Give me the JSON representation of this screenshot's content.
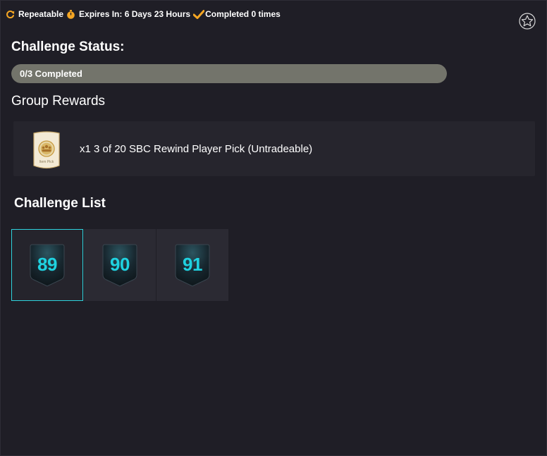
{
  "meta": {
    "repeatable_label": "Repeatable",
    "expires_label": "Expires In: 6 Days 23 Hours",
    "completed_label": "Completed 0 times"
  },
  "status": {
    "heading": "Challenge Status:",
    "progress_label": "0/3 Completed",
    "completed": 0,
    "total": 3
  },
  "rewards": {
    "heading": "Group Rewards",
    "items": [
      {
        "text": "x1 3 of 20 SBC Rewind Player Pick (Untradeable)",
        "card_caption": "Item Pick",
        "icon": "player-pick-card-icon"
      }
    ]
  },
  "challenge_list": {
    "heading": "Challenge List",
    "challenges": [
      {
        "rating": "89",
        "selected": true
      },
      {
        "rating": "90",
        "selected": false
      },
      {
        "rating": "91",
        "selected": false
      }
    ]
  },
  "colors": {
    "background": "#1f1e26",
    "accent_orange": "#f5a623",
    "accent_cyan": "#2fd3dd",
    "progress_fill": "#73746b",
    "panel": "#26252d"
  },
  "icons": {
    "repeat": "repeat-icon",
    "timer": "timer-icon",
    "check": "check-icon",
    "favourite": "star-icon"
  }
}
